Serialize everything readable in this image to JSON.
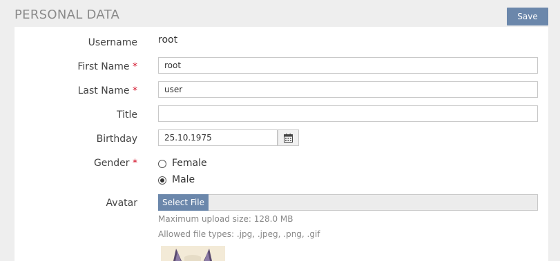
{
  "header": {
    "title": "PERSONAL DATA",
    "save_label": "Save"
  },
  "form": {
    "required_marker": "*",
    "username": {
      "label": "Username",
      "value": "root"
    },
    "first_name": {
      "label": "First Name",
      "value": "root",
      "required": true
    },
    "last_name": {
      "label": "Last Name",
      "value": "user",
      "required": true
    },
    "title": {
      "label": "Title",
      "value": ""
    },
    "birthday": {
      "label": "Birthday",
      "value": "25.10.1975",
      "icon": "calendar-icon"
    },
    "gender": {
      "label": "Gender",
      "required": true,
      "options": [
        {
          "label": "Female",
          "checked": false
        },
        {
          "label": "Male",
          "checked": true
        }
      ]
    },
    "avatar": {
      "label": "Avatar",
      "select_label": "Select File",
      "max_size_text": "Maximum upload size: 128.0 MB",
      "allowed_types_text": "Allowed file types: .jpg, .jpeg, .png, .gif"
    }
  },
  "colors": {
    "accent": "#6b87ab",
    "required": "#d0021b",
    "background": "#eeeeee",
    "panel": "#ffffff"
  }
}
